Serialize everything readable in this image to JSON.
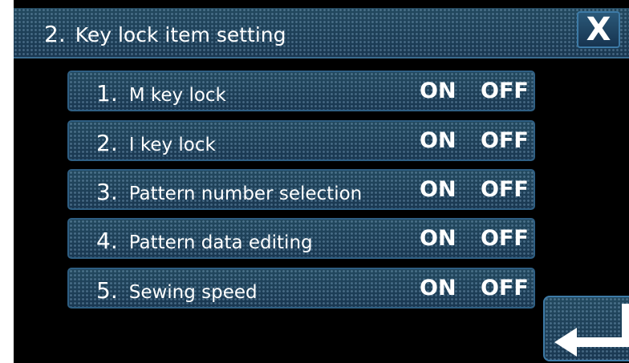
{
  "title": {
    "number": "2.",
    "text": "Key lock item setting"
  },
  "close_label": "X",
  "items": [
    {
      "number": "1.",
      "label": "M key lock",
      "on": "ON",
      "off": "OFF"
    },
    {
      "number": "2.",
      "label": "I key lock",
      "on": "ON",
      "off": "OFF"
    },
    {
      "number": "3.",
      "label": "Pattern number selection",
      "on": "ON",
      "off": "OFF"
    },
    {
      "number": "4.",
      "label": "Pattern data editing",
      "on": "ON",
      "off": "OFF"
    },
    {
      "number": "5.",
      "label": "Sewing speed",
      "on": "ON",
      "off": "OFF"
    }
  ],
  "icons": {
    "close": "close-icon",
    "enter": "enter-arrow-icon"
  },
  "colors": {
    "background": "#000000",
    "button_fill": "#1d3f5a",
    "button_border": "#2e5e82",
    "text": "#ffffff"
  }
}
